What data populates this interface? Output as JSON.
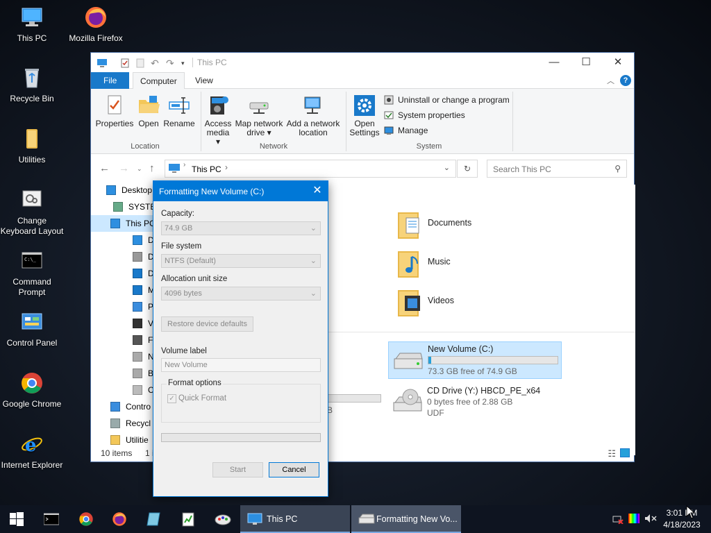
{
  "desktop": {
    "icons": [
      {
        "label": "This PC",
        "icon": "computer-icon"
      },
      {
        "label": "Mozilla Firefox",
        "icon": "firefox-icon"
      },
      {
        "label": "Recycle Bin",
        "icon": "recycle-bin-icon"
      },
      {
        "label": "Utilities",
        "icon": "folder-icon"
      },
      {
        "label": "Change Keyboard Layout",
        "icon": "keyboard-icon"
      },
      {
        "label": "Command Prompt",
        "icon": "terminal-icon"
      },
      {
        "label": "Control Panel",
        "icon": "control-panel-icon"
      },
      {
        "label": "Google Chrome",
        "icon": "chrome-icon"
      },
      {
        "label": "Internet Explorer",
        "icon": "ie-icon"
      }
    ]
  },
  "explorer": {
    "title": "This PC",
    "tabs": {
      "file": "File",
      "computer": "Computer",
      "view": "View"
    },
    "ribbon": {
      "properties": "Properties",
      "open": "Open",
      "rename": "Rename",
      "access_media_1": "Access",
      "access_media_2": "media ▾",
      "map_drive_1": "Map network",
      "map_drive_2": "drive ▾",
      "add_loc_1": "Add a network",
      "add_loc_2": "location",
      "open_settings_1": "Open",
      "open_settings_2": "Settings",
      "uninstall": "Uninstall or change a program",
      "system_props": "System properties",
      "manage": "Manage",
      "group_location": "Location",
      "group_network": "Network",
      "group_system": "System"
    },
    "address": {
      "crumb": "This PC",
      "search_placeholder": "Search This PC"
    },
    "nav": [
      {
        "label": "Desktop",
        "icon": "desktop-icon"
      },
      {
        "label": "SYSTEM",
        "icon": "user-icon"
      },
      {
        "label": "This PC",
        "icon": "computer-icon"
      },
      {
        "label": "Deskt",
        "icon": "desktop-icon"
      },
      {
        "label": "Docu",
        "icon": "documents-icon"
      },
      {
        "label": "Down",
        "icon": "downloads-icon"
      },
      {
        "label": "Music",
        "icon": "music-icon"
      },
      {
        "label": "Pictur",
        "icon": "pictures-icon"
      },
      {
        "label": "Video",
        "icon": "videos-icon"
      },
      {
        "label": "Flopp",
        "icon": "floppy-icon"
      },
      {
        "label": "New V",
        "icon": "drive-icon"
      },
      {
        "label": "Boot",
        "icon": "drive-icon"
      },
      {
        "label": "CD Dr",
        "icon": "cd-icon"
      },
      {
        "label": "Contro",
        "icon": "control-panel-icon"
      },
      {
        "label": "Recycl",
        "icon": "recycle-bin-icon"
      },
      {
        "label": "Utilitie",
        "icon": "folder-icon"
      }
    ],
    "folders": [
      {
        "name": "Documents",
        "icon": "documents-folder-icon"
      },
      {
        "name": "Music",
        "icon": "music-folder-icon"
      },
      {
        "name": "Videos",
        "icon": "videos-folder-icon"
      }
    ],
    "drives": [
      {
        "name": "New Volume (C:)",
        "free": "73.3 GB free of 74.9 GB",
        "used_fraction": 0.02,
        "icon": "hard-drive-icon"
      },
      {
        "name": "CD Drive (Y:) HBCD_PE_x64",
        "free": "0 bytes free of 2.88 GB",
        "fs": "UDF",
        "icon": "cd-drive-icon"
      }
    ],
    "hidden_drive_label": "B",
    "status": {
      "count": "10 items",
      "selected": "1 i"
    }
  },
  "dialog": {
    "title": "Formatting New Volume (C:)",
    "capacity_label": "Capacity:",
    "capacity_value": "74.9 GB",
    "fs_label": "File system",
    "fs_value": "NTFS (Default)",
    "alloc_label": "Allocation unit size",
    "alloc_value": "4096 bytes",
    "restore_btn": "Restore device defaults",
    "volume_label": "Volume label",
    "volume_value": "New Volume",
    "format_options": "Format options",
    "quick_format": "Quick Format",
    "progress": 0,
    "start_btn": "Start",
    "cancel_btn": "Cancel"
  },
  "taskbar": {
    "pinned": [
      "start-icon",
      "terminal-icon",
      "chrome-icon",
      "firefox-icon",
      "notepad-icon",
      "spreadsheet-icon",
      "paint-icon"
    ],
    "windows": [
      {
        "label": "This PC",
        "icon": "computer-icon"
      },
      {
        "label": "Formatting New Vo...",
        "icon": "drive-icon"
      }
    ],
    "time": "3:01 PM",
    "date": "4/18/2023"
  },
  "colors": {
    "accent": "#0078d7",
    "taskbar": "#0e1420",
    "folder": "#f3c759"
  }
}
